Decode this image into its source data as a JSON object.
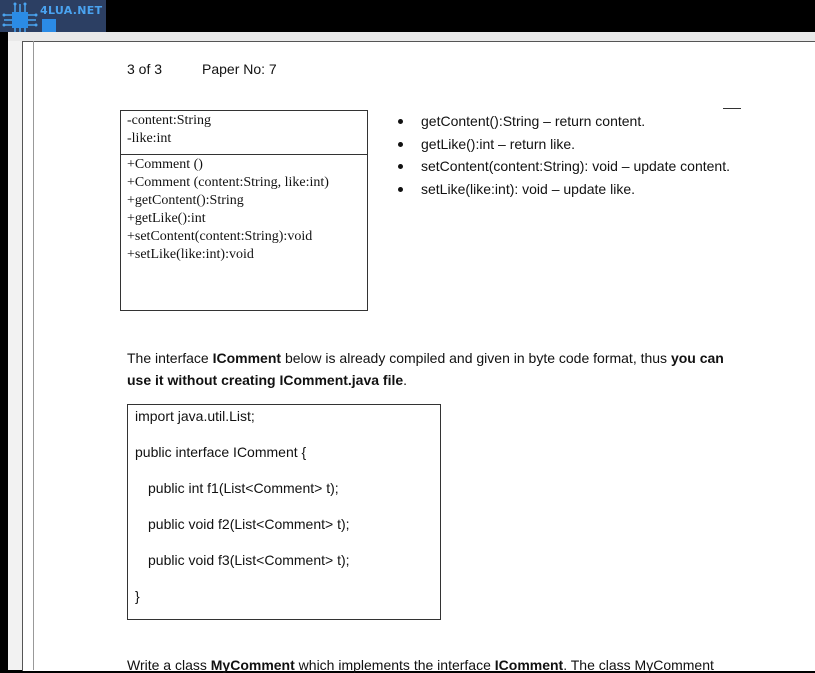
{
  "logo": {
    "text": "4LUA.NET"
  },
  "header": {
    "page": "3 of 3",
    "paper": "Paper No: 7"
  },
  "uml": {
    "attributes": [
      "-content:String",
      "-like:int"
    ],
    "methods": [
      "+Comment ()",
      "+Comment (content:String, like:int)",
      "+getContent():String",
      "+getLike():int",
      "+setContent(content:String):void",
      "+setLike(like:int):void"
    ]
  },
  "bullets": [
    "getContent():String – return content.",
    "getLike():int – return like.",
    "setContent(content:String): void – update content.",
    "setLike(like:int): void – update like."
  ],
  "para": {
    "p1": "The interface ",
    "b1": "IComment",
    "p2": " below is already compiled and given in byte code format, thus ",
    "b2": "you can use it without creating IComment.java file",
    "p3": "."
  },
  "code": [
    "import java.util.List;",
    "public interface IComment {",
    "public int f1(List<Comment> t);",
    "public void f2(List<Comment> t);",
    "public void f3(List<Comment> t);",
    "}"
  ],
  "bottom": {
    "p1": "Write a class ",
    "b1": "MyComment",
    "p2": " which implements the interface ",
    "b2": "IComment",
    "p3": ". The class MyComment"
  }
}
